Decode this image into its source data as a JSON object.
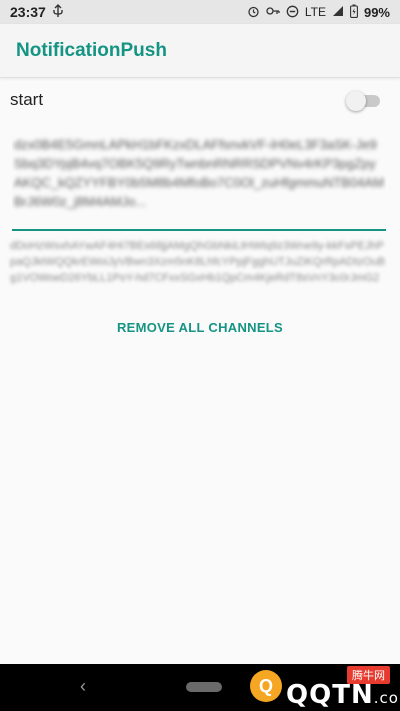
{
  "status_bar": {
    "time": "23:37",
    "network": "LTE",
    "battery": "99%",
    "icons": [
      "usb-icon",
      "alarm-icon",
      "key-icon",
      "dnd-icon",
      "signal-icon",
      "battery-icon"
    ]
  },
  "app_bar": {
    "title": "NotificationPush",
    "accent_color": "#159484"
  },
  "start": {
    "label": "start",
    "toggle_on": false
  },
  "token_field": {
    "value": "dzx0B4E5GmnLAPkH1bFKzxDLAFfsnvkVF-iH0eL3F3aSK-Je9Sbq3DYpjB4vq7OBK5Q9RyTwnbnRNRRSDPVNv4rKP3pgZpyAKQC_kQZYYFBY0b5M8b4MfoBo7C0Ol_zuHfgmmuNTB04AMBrJ6W0z_j8M4AMJo..."
  },
  "info_text": {
    "value": "dDoHzWsxhAYwAF4Hi7BEs68jjAMgQhGbNkiLtHWtq9z3Wne9y-kkFsPEJhPpaQJktWQQkrEWoiJyVBwn3Xzm5nK8LhfcYPpjFgghUTJuZiKQrRpADtzOuBg1VOWoeD26YbLL1PoY-hd7CFxxSGxHb1QpCm4KjeRdT8sVnY3c0rJmG2"
  },
  "remove_button": {
    "label": "REMOVE ALL CHANNELS"
  },
  "nav_bar": {
    "back_glyph": "‹"
  },
  "watermark": {
    "site_cn": "腾牛网",
    "logo_letter": "Q",
    "brand": "QQTN",
    "domain": ".com"
  }
}
